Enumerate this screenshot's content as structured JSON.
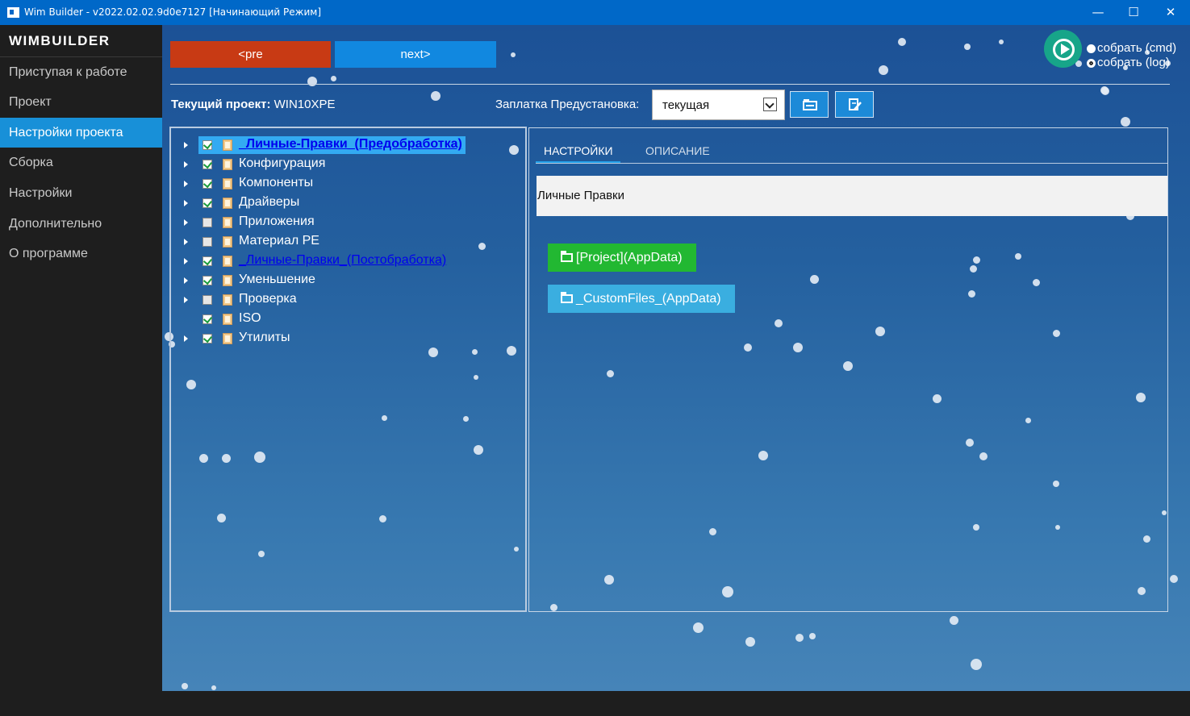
{
  "window": {
    "title": "Wim Builder - v2022.02.02.9d0e7127 [Начинающий Режим]",
    "minimize": "—",
    "maximize": "☐",
    "close": "✕"
  },
  "sidebar": {
    "brand": "WIMBUILDER",
    "items": [
      {
        "label": "Приступая к работе"
      },
      {
        "label": "Проект"
      },
      {
        "label": "Настройки проекта",
        "active": true
      },
      {
        "label": "Сборка"
      },
      {
        "label": "Настройки"
      },
      {
        "label": "Дополнительно"
      },
      {
        "label": "О программе"
      }
    ]
  },
  "toolbar": {
    "pre_label": "<pre",
    "next_label": "next>",
    "build_cmd_label": "собрать (cmd)",
    "build_log_label": "собрать (log)",
    "build_selected": "log"
  },
  "project": {
    "current_label": "Текущий проект:",
    "current_value": "WIN10XPE",
    "patch_label": "Заплатка Предустановка:",
    "patch_select_value": "текущая"
  },
  "tree": {
    "items": [
      {
        "label": "_Личные-Правки_(Предобработка)",
        "checked": true,
        "style": "selected"
      },
      {
        "label": "Конфигурация",
        "checked": true,
        "style": "normal"
      },
      {
        "label": "Компоненты",
        "checked": true,
        "style": "normal"
      },
      {
        "label": "Драйверы",
        "checked": true,
        "style": "normal"
      },
      {
        "label": "Приложения",
        "checked": false,
        "style": "normal"
      },
      {
        "label": "Материал PE",
        "checked": false,
        "style": "normal"
      },
      {
        "label": "_Личные-Правки_(Постобработка)",
        "checked": true,
        "style": "blue"
      },
      {
        "label": "Уменьшение",
        "checked": true,
        "style": "normal"
      },
      {
        "label": "Проверка",
        "checked": false,
        "style": "normal"
      },
      {
        "label": "ISO",
        "checked": true,
        "style": "normal"
      },
      {
        "label": "Утилиты",
        "checked": true,
        "style": "normal"
      }
    ]
  },
  "details": {
    "tabs": [
      {
        "label": "НАСТРОЙКИ",
        "active": true
      },
      {
        "label": "ОПИСАНИЕ",
        "active": false
      }
    ],
    "description": "Личные Правки",
    "buttons": [
      {
        "label": "[Project](AppData)",
        "color": "#22b832"
      },
      {
        "label": "_CustomFiles_(AppData)",
        "color": "#3aaee0"
      }
    ]
  },
  "colors": {
    "pre_button": "#c83a14",
    "next_button": "#1188e0",
    "sidebar_active": "#1890d8",
    "play_button": "#17a589"
  }
}
